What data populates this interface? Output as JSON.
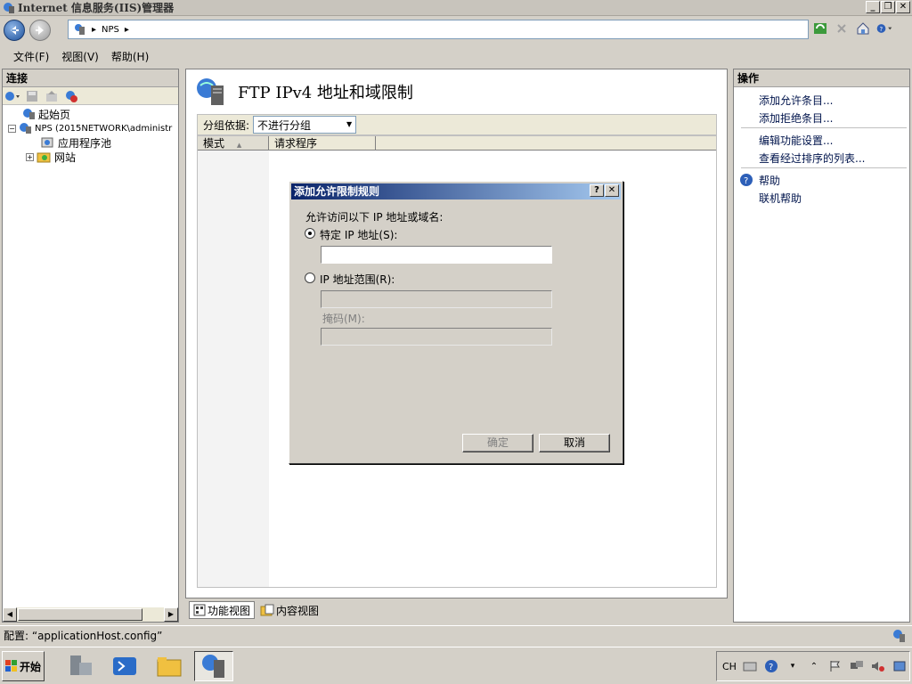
{
  "window": {
    "title": "Internet 信息服务(IIS)管理器",
    "minimize": "_",
    "restore": "❐",
    "close": "✕"
  },
  "address": {
    "crumb": "NPS",
    "sep": "▸"
  },
  "menu": {
    "file": "文件(F)",
    "view": "视图(V)",
    "help": "帮助(H)"
  },
  "connections": {
    "header": "连接",
    "tree": {
      "start_page": "起始页",
      "server": "NPS (2015NETWORK\\administr",
      "app_pools": "应用程序池",
      "sites": "网站"
    }
  },
  "center": {
    "title": "FTP IPv4 地址和域限制",
    "group_by_label": "分组依据:",
    "group_by_value": "不进行分组",
    "col_mode": "模式",
    "col_requestor": "请求程序",
    "tab_features": "功能视图",
    "tab_content": "内容视图"
  },
  "actions": {
    "header": "操作",
    "add_allow": "添加允许条目...",
    "add_deny": "添加拒绝条目...",
    "edit_settings": "编辑功能设置...",
    "view_sorted": "查看经过排序的列表...",
    "help": "帮助",
    "online_help": "联机帮助"
  },
  "dialog": {
    "title": "添加允许限制规则",
    "help_btn": "?",
    "close_btn": "✕",
    "prompt": "允许访问以下 IP 地址或域名:",
    "specific_ip_label": "特定 IP 地址(S):",
    "specific_ip_value": "",
    "ip_range_label": "IP 地址范围(R):",
    "ip_range_value": "",
    "mask_label": "掩码(M):",
    "mask_value": "",
    "ok": "确定",
    "cancel": "取消",
    "selected_option": "specific_ip"
  },
  "status": {
    "text": "配置: “applicationHost.config”"
  },
  "taskbar": {
    "start": "开始",
    "ime": "CH"
  }
}
